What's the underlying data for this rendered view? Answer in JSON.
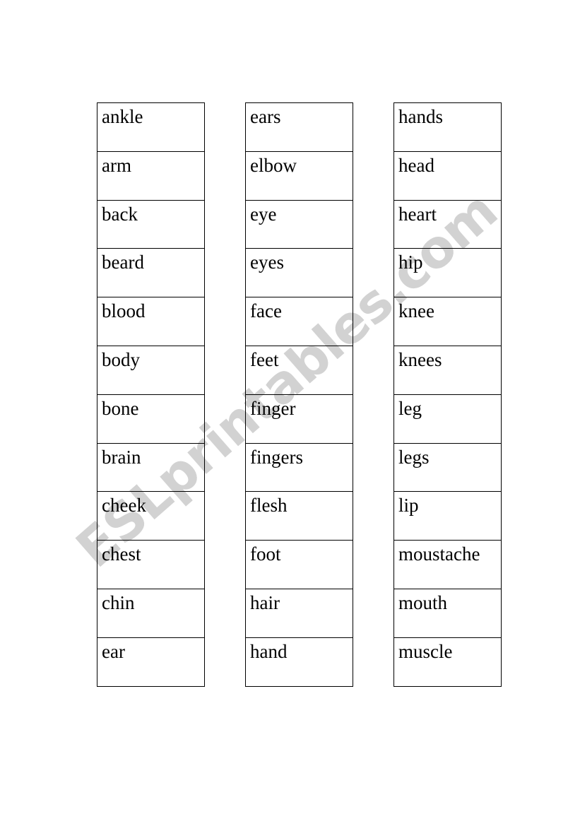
{
  "document": {
    "type": "vocabulary-word-list-worksheet",
    "background_color": "#ffffff",
    "text_color": "#000000",
    "border_color": "#000000"
  },
  "watermark": {
    "text": "ESLprintables.com",
    "color": "#d2d2d2",
    "rotation_degrees": -41
  },
  "columns": [
    {
      "name": "column-1",
      "words": [
        "ankle",
        "arm",
        "back",
        "beard",
        "blood",
        "body",
        "bone",
        "brain",
        "cheek",
        "chest",
        "chin",
        "ear"
      ]
    },
    {
      "name": "column-2",
      "words": [
        "ears",
        "elbow",
        "eye",
        "eyes",
        "face",
        "feet",
        "finger",
        "fingers",
        "flesh",
        "foot",
        "hair",
        "hand"
      ]
    },
    {
      "name": "column-3",
      "words": [
        "hands",
        "head",
        "heart",
        "hip",
        "knee",
        "knees",
        "leg",
        "legs",
        "lip",
        "moustache",
        "mouth",
        "muscle"
      ]
    }
  ]
}
